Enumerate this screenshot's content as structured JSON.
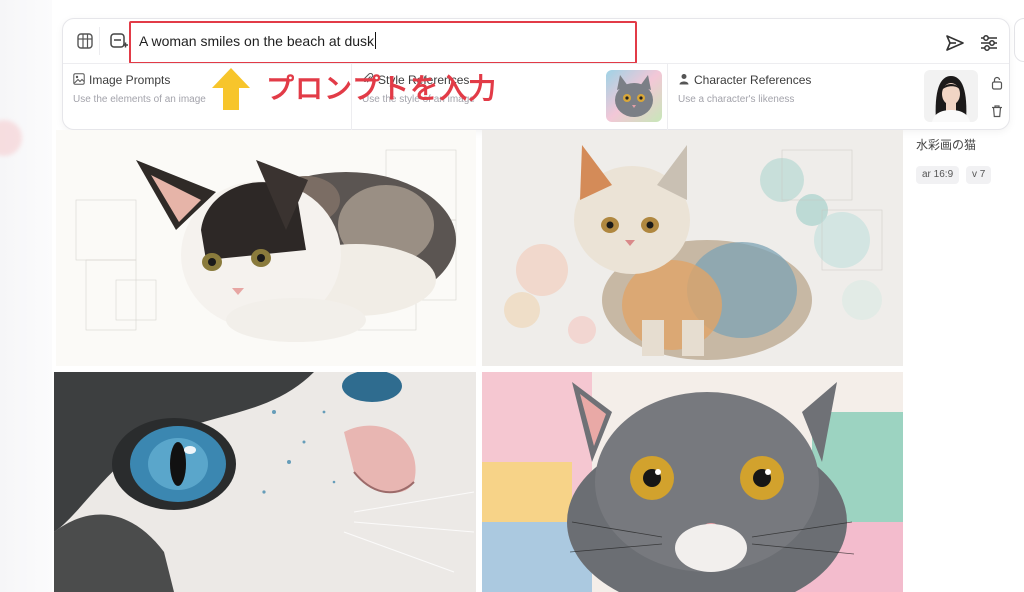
{
  "prompt": {
    "value": "A woman smiles on the beach at dusk"
  },
  "references": [
    {
      "icon": "image-icon",
      "title": "Image Prompts",
      "subtitle": "Use the elements of an image"
    },
    {
      "icon": "paperclip-icon",
      "title": "Style References",
      "subtitle": "Use the style of an image"
    },
    {
      "icon": "person-icon",
      "title": "Character References",
      "subtitle": "Use a character's likeness"
    }
  ],
  "annotation": {
    "text": "プロンプトを入力"
  },
  "side_info": {
    "title": "水彩画の猫",
    "chips": [
      "ar 16:9",
      "v 7"
    ]
  },
  "colors": {
    "accent_red": "#e23b47",
    "arrow_yellow": "#f7c52b"
  }
}
